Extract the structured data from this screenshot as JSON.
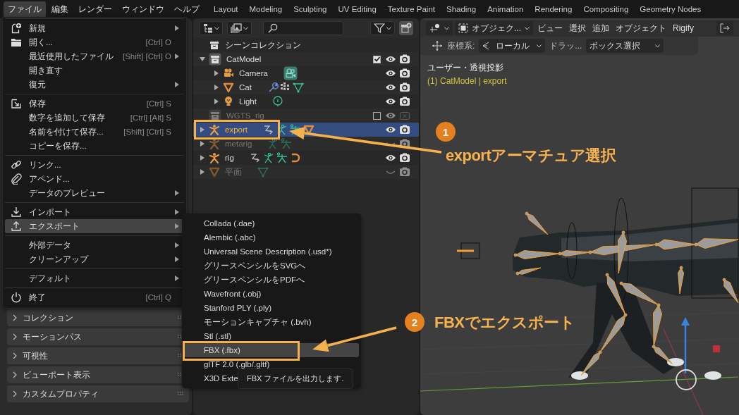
{
  "menubar": {
    "items": [
      {
        "label": "ファイル",
        "selected": true
      },
      {
        "label": "編集",
        "selected": false
      },
      {
        "label": "レンダー",
        "selected": false
      },
      {
        "label": "ウィンドウ",
        "selected": false
      },
      {
        "label": "ヘルプ",
        "selected": false
      }
    ]
  },
  "workspace_tabs": [
    {
      "label": "Layout",
      "selected": false
    },
    {
      "label": "Modeling",
      "selected": false
    },
    {
      "label": "Sculpting",
      "selected": false
    },
    {
      "label": "UV Editing",
      "selected": false
    },
    {
      "label": "Texture Paint",
      "selected": false
    },
    {
      "label": "Shading",
      "selected": false
    },
    {
      "label": "Animation",
      "selected": false
    },
    {
      "label": "Rendering",
      "selected": false
    },
    {
      "label": "Compositing",
      "selected": false
    },
    {
      "label": "Geometry Nodes",
      "selected": false
    }
  ],
  "file_menu": {
    "sections": [
      [
        {
          "kind": "new-file",
          "label": "新規",
          "submenu": true,
          "selected": false
        },
        {
          "kind": "open",
          "label": "開く...",
          "shortcut": "[Ctrl] O",
          "submenu": false,
          "selected": false
        },
        {
          "kind": "plain",
          "label": "最近使用したファイル",
          "shortcut": "[Shift] [Ctrl] O",
          "submenu": true,
          "selected": false
        },
        {
          "kind": "plain",
          "label": "開き直す",
          "submenu": false,
          "selected": false
        },
        {
          "kind": "plain",
          "label": "復元",
          "submenu": true,
          "selected": false
        }
      ],
      [
        {
          "kind": "save",
          "label": "保存",
          "shortcut": "[Ctrl] S",
          "submenu": false,
          "selected": false
        },
        {
          "kind": "plain",
          "label": "数字を追加して保存",
          "shortcut": "[Ctrl] [Alt] S",
          "submenu": false,
          "selected": false
        },
        {
          "kind": "plain",
          "label": "名前を付けて保存...",
          "shortcut": "[Shift] [Ctrl] S",
          "submenu": false,
          "selected": false
        },
        {
          "kind": "plain",
          "label": "コピーを保存...",
          "submenu": false,
          "selected": false
        }
      ],
      [
        {
          "kind": "link",
          "label": "リンク...",
          "submenu": false,
          "selected": false
        },
        {
          "kind": "append",
          "label": "アペンド...",
          "submenu": false,
          "selected": false
        },
        {
          "kind": "plain",
          "label": "データのプレビュー",
          "submenu": true,
          "selected": false
        }
      ],
      [
        {
          "kind": "import",
          "label": "インポート",
          "submenu": true,
          "selected": false
        },
        {
          "kind": "export",
          "label": "エクスポート",
          "submenu": true,
          "selected": true
        }
      ],
      [
        {
          "kind": "plain",
          "label": "外部データ",
          "submenu": true,
          "selected": false
        },
        {
          "kind": "plain",
          "label": "クリーンアップ",
          "submenu": true,
          "selected": false
        }
      ],
      [
        {
          "kind": "plain",
          "label": "デフォルト",
          "submenu": true,
          "selected": false
        }
      ],
      [
        {
          "kind": "quit",
          "label": "終了",
          "shortcut": "[Ctrl] Q",
          "submenu": false,
          "selected": false
        }
      ]
    ]
  },
  "export_menu": {
    "items": [
      {
        "label": "Collada (.dae)",
        "selected": false
      },
      {
        "label": "Alembic (.abc)",
        "selected": false
      },
      {
        "label": "Universal Scene Description (.usd*)",
        "selected": false
      },
      {
        "label": "グリースペンシルをSVGへ",
        "selected": false
      },
      {
        "label": "グリースペンシルをPDFへ",
        "selected": false
      },
      {
        "label": "Wavefront (.obj)",
        "selected": false
      },
      {
        "label": "Stanford PLY (.ply)",
        "selected": false
      },
      {
        "label": "モーションキャプチャ (.bvh)",
        "selected": false
      },
      {
        "label": "Stl (.stl)",
        "selected": false
      },
      {
        "label": "FBX (.fbx)",
        "selected": true
      },
      {
        "label": "glTF 2.0 (.glb/.gltf)",
        "selected": false
      },
      {
        "label": "X3D Exte",
        "selected": false
      }
    ],
    "tooltip": "FBX ファイルを出力します."
  },
  "properties": {
    "panels": [
      {
        "label": "コレクション",
        "expanded": false
      },
      {
        "label": "モーションパス",
        "expanded": false
      },
      {
        "label": "可視性",
        "expanded": false
      },
      {
        "label": "ビューポート表示",
        "expanded": false
      },
      {
        "label": "カスタムプロパティ",
        "expanded": false
      }
    ]
  },
  "outliner": {
    "tree": {
      "label": "シーンコレクション",
      "kind": "scene",
      "children": [
        {
          "label": "CatModel",
          "kind": "collection",
          "expanded": true,
          "checked": true,
          "visible": true,
          "renderable": true,
          "enabled": true,
          "selected": false,
          "children": [
            {
              "label": "Camera",
              "kind": "camera",
              "expanded": false,
              "visible": true,
              "renderable": true,
              "enabled": true,
              "selected": false,
              "extras": [
                {
                  "kind": "camera-data"
                }
              ]
            },
            {
              "label": "Cat",
              "kind": "mesh",
              "expanded": false,
              "visible": true,
              "renderable": true,
              "enabled": true,
              "selected": false,
              "extras": [
                {
                  "kind": "modifier"
                },
                {
                  "kind": "vertex-groups"
                },
                {
                  "kind": "mesh-data"
                }
              ]
            },
            {
              "label": "Light",
              "kind": "light",
              "expanded": false,
              "visible": true,
              "renderable": true,
              "enabled": true,
              "selected": false,
              "extras": [
                {
                  "kind": "light-data"
                }
              ]
            }
          ]
        },
        {
          "label": "WGTS_rig",
          "kind": "collection",
          "checked": false,
          "visible": true,
          "renderable": false,
          "enabled": false,
          "selected": false
        },
        {
          "label": "export",
          "kind": "armature",
          "expanded": false,
          "visible": true,
          "renderable": true,
          "enabled": true,
          "selected": true,
          "extras": [
            {
              "kind": "pose"
            },
            {
              "kind": "bones"
            },
            {
              "kind": "armature-data"
            },
            {
              "kind": "mesh"
            }
          ]
        },
        {
          "label": "metarig",
          "kind": "armature",
          "expanded": false,
          "visible": false,
          "renderable": true,
          "enabled": false,
          "selected": false,
          "extras": [
            {
              "kind": "bones"
            },
            {
              "kind": "armature-data"
            }
          ]
        },
        {
          "label": "rig",
          "kind": "armature",
          "expanded": false,
          "visible": true,
          "renderable": true,
          "enabled": true,
          "selected": false,
          "extras": [
            {
              "kind": "pose"
            },
            {
              "kind": "bones"
            },
            {
              "kind": "armature-data"
            },
            {
              "kind": "hook"
            }
          ]
        },
        {
          "label": "平面",
          "kind": "mesh",
          "expanded": false,
          "visible": false,
          "renderable": true,
          "enabled": false,
          "selected": false,
          "extras": [
            {
              "kind": "mesh-data"
            }
          ]
        }
      ]
    }
  },
  "viewport": {
    "mode": "オブジェク...",
    "menus": [
      "ビュー",
      "選択",
      "追加",
      "オブジェクト",
      "Rigify"
    ],
    "orientation_label": "座標系:",
    "orientation": "ローカル",
    "drag_label": "ドラッ...",
    "select_mode": "ボックス選択",
    "view_name": "ユーザー・透視投影",
    "object_info": "(1) CatModel | export"
  },
  "annotations": [
    {
      "number": "1",
      "text": "exportアーマチュア選択"
    },
    {
      "number": "2",
      "text": "FBXでエクスポート"
    }
  ]
}
